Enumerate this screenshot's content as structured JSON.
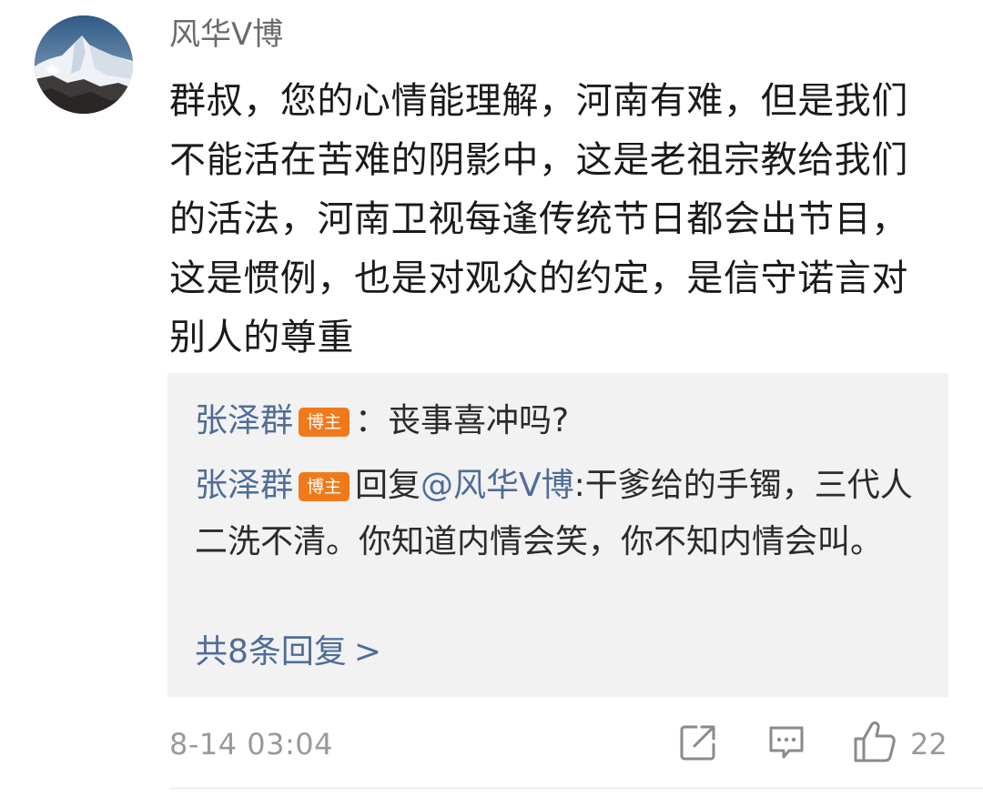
{
  "author": {
    "name": "风华V博",
    "avatar_icon": "mountain-avatar"
  },
  "comment": {
    "text": "群叔，您的心情能理解，河南有难，但是我们不能活在苦难的阴影中，这是老祖宗教给我们的活法，河南卫视每逢传统节日都会出节目，这是惯例，也是对观众的约定，是信守诺言对别人的尊重"
  },
  "replies": [
    {
      "user": "张泽群",
      "badge": "博主",
      "separator": "：",
      "text": "丧事喜冲吗?"
    },
    {
      "user": "张泽群",
      "badge": "博主",
      "reply_prefix": "回复",
      "mention": "@风华V博",
      "text": ":干爹给的手镯，三代人二洗不清。你知道内情会笑，你不知内情会叫。"
    }
  ],
  "more_replies": {
    "label": "共8条回复",
    "chevron": ">"
  },
  "footer": {
    "timestamp": "8-14 03:04",
    "like_count": "22",
    "share_icon": "share-icon",
    "comment_icon": "comment-icon",
    "like_icon": "thumbs-up-icon"
  },
  "colors": {
    "username_link": "#4f6d98",
    "badge": "#f07a1a",
    "reply_background": "#f2f2f2",
    "meta_text": "#9a9a9a"
  }
}
